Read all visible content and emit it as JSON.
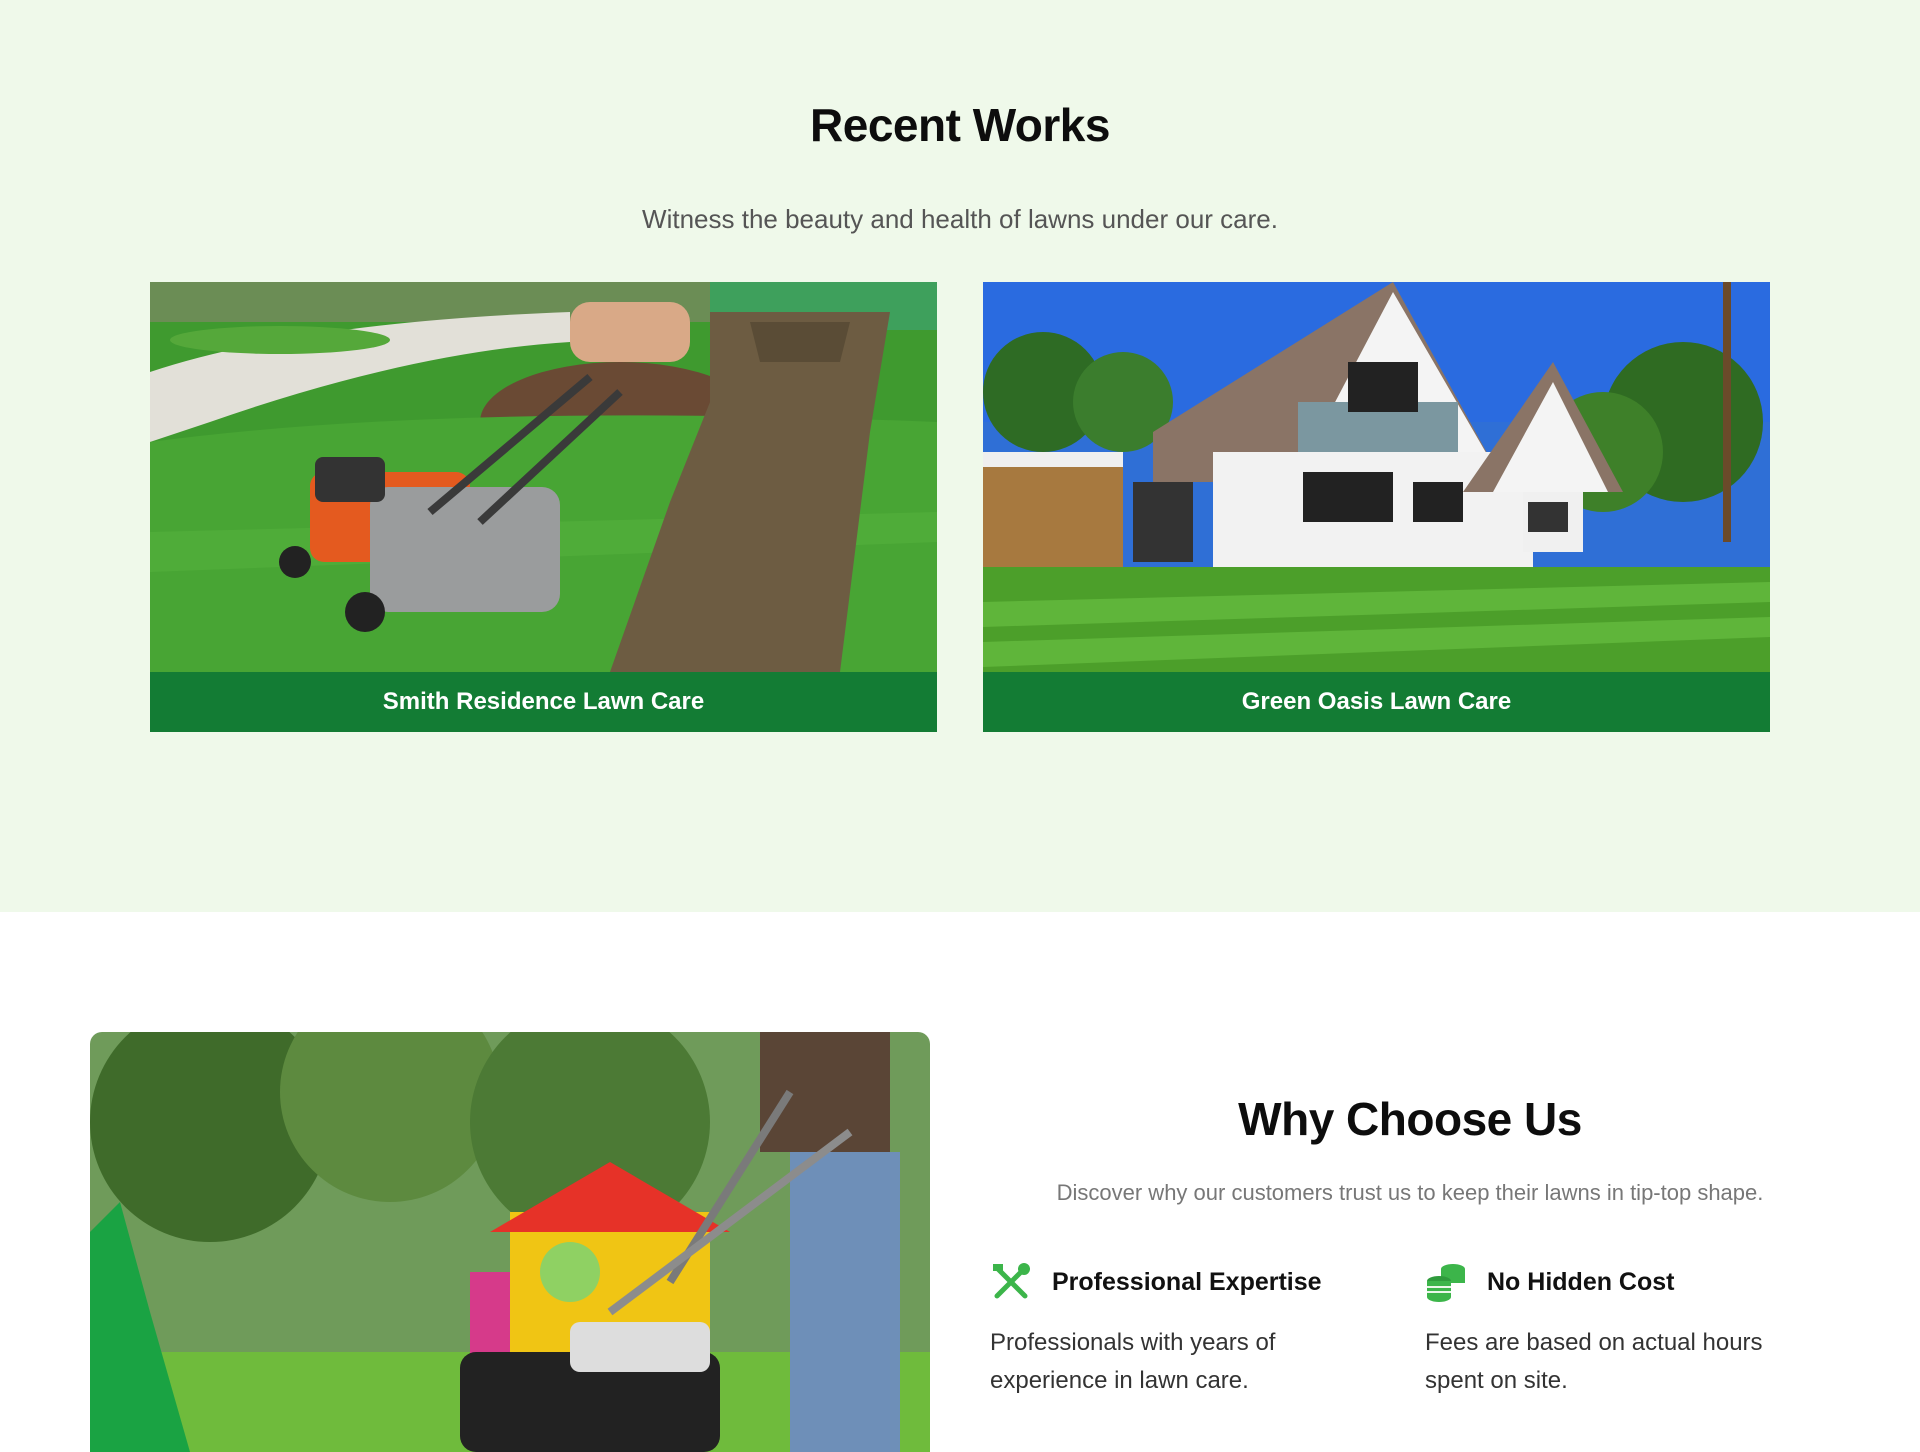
{
  "recent_works": {
    "title": "Recent Works",
    "subtitle": "Witness the beauty and health of lawns under our care.",
    "items": [
      {
        "caption": "Smith Residence Lawn Care"
      },
      {
        "caption": "Green Oasis Lawn Care"
      }
    ]
  },
  "why_choose_us": {
    "title": "Why Choose Us",
    "subtitle": "Discover why our customers trust us to keep their lawns in tip-top shape.",
    "features": [
      {
        "icon": "tools-icon",
        "title": "Professional Expertise",
        "description": "Professionals with years of experience in lawn care."
      },
      {
        "icon": "coins-icon",
        "title": "No Hidden Cost",
        "description": "Fees are based on actual hours spent on site."
      }
    ]
  },
  "colors": {
    "section_background": "#eff9ea",
    "caption_green": "#137c34",
    "icon_green": "#3cb54a"
  }
}
